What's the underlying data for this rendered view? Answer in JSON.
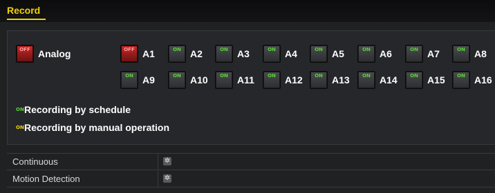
{
  "title": "Record",
  "analog": {
    "state": "OFF",
    "label": "Analog"
  },
  "channels": [
    {
      "label": "A1",
      "state": "OFF"
    },
    {
      "label": "A2",
      "state": "ON"
    },
    {
      "label": "A3",
      "state": "ON"
    },
    {
      "label": "A4",
      "state": "ON"
    },
    {
      "label": "A5",
      "state": "ON"
    },
    {
      "label": "A6",
      "state": "ON"
    },
    {
      "label": "A7",
      "state": "ON"
    },
    {
      "label": "A8",
      "state": "ON"
    },
    {
      "label": "A9",
      "state": "ON"
    },
    {
      "label": "A10",
      "state": "ON"
    },
    {
      "label": "A11",
      "state": "ON"
    },
    {
      "label": "A12",
      "state": "ON"
    },
    {
      "label": "A13",
      "state": "ON"
    },
    {
      "label": "A14",
      "state": "ON"
    },
    {
      "label": "A15",
      "state": "ON"
    },
    {
      "label": "A16",
      "state": "ON"
    }
  ],
  "legend": {
    "schedule": {
      "tag": "ON",
      "text": "Recording by schedule"
    },
    "manual": {
      "tag": "ON",
      "text": "Recording by manual operation"
    }
  },
  "table": {
    "rows": [
      {
        "label": "Continuous",
        "icon": "gear-icon"
      },
      {
        "label": "Motion Detection",
        "icon": "gear-icon"
      }
    ]
  },
  "colors": {
    "title": "#f2d200",
    "on": "#5cd13a",
    "off": "#c92a2a",
    "manual": "#f2d200"
  }
}
